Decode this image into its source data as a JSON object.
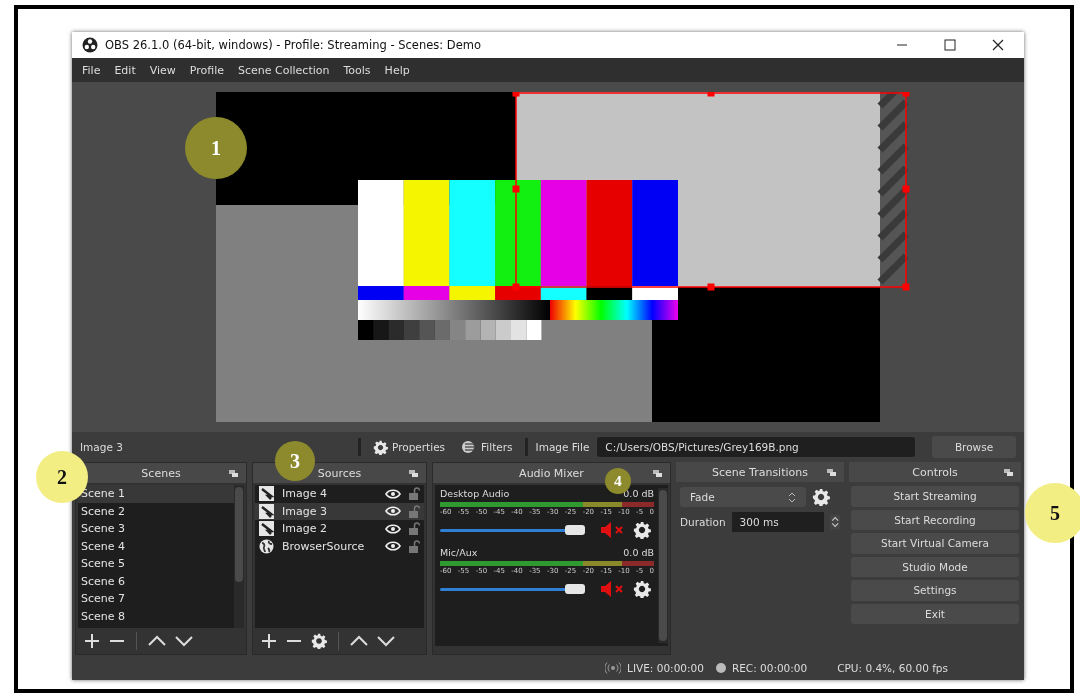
{
  "window": {
    "title": "OBS 26.1.0 (64-bit, windows) - Profile: Streaming - Scenes: Demo"
  },
  "menu": [
    "File",
    "Edit",
    "View",
    "Profile",
    "Scene Collection",
    "Tools",
    "Help"
  ],
  "source_toolbar": {
    "selected_source": "Image 3",
    "properties": "Properties",
    "filters": "Filters",
    "file_label": "Image File",
    "file_path": "C:/Users/OBS/Pictures/Grey169B.png",
    "browse": "Browse"
  },
  "scenes": {
    "title": "Scenes",
    "items": [
      {
        "label": "Scene 1",
        "selected": true
      },
      {
        "label": "Scene 2",
        "selected": false
      },
      {
        "label": "Scene 3",
        "selected": false
      },
      {
        "label": "Scene 4",
        "selected": false
      },
      {
        "label": "Scene 5",
        "selected": false
      },
      {
        "label": "Scene 6",
        "selected": false
      },
      {
        "label": "Scene 7",
        "selected": false
      },
      {
        "label": "Scene 8",
        "selected": false
      }
    ]
  },
  "sources": {
    "title": "Sources",
    "items": [
      {
        "label": "Image 4",
        "kind": "image",
        "selected": false,
        "visible": true,
        "locked": false
      },
      {
        "label": "Image 3",
        "kind": "image",
        "selected": true,
        "visible": true,
        "locked": false
      },
      {
        "label": "Image 2",
        "kind": "image",
        "selected": false,
        "visible": true,
        "locked": false
      },
      {
        "label": "BrowserSource",
        "kind": "browser",
        "selected": false,
        "visible": true,
        "locked": false
      }
    ]
  },
  "audio_mixer": {
    "title": "Audio Mixer",
    "channels": [
      {
        "name": "Desktop Audio",
        "reading": "0.0 dB",
        "scale": [
          "-60",
          "-55",
          "-50",
          "-45",
          "-40",
          "-35",
          "-30",
          "-25",
          "-20",
          "-15",
          "-10",
          "-5",
          "0"
        ],
        "level": 0.87,
        "muted": true
      },
      {
        "name": "Mic/Aux",
        "reading": "0.0 dB",
        "scale": [
          "-60",
          "-55",
          "-50",
          "-45",
          "-40",
          "-35",
          "-30",
          "-25",
          "-20",
          "-15",
          "-10",
          "-5",
          "0"
        ],
        "level": 0.87,
        "muted": true
      }
    ]
  },
  "scene_transitions": {
    "title": "Scene Transitions",
    "transition": "Fade",
    "duration_label": "Duration",
    "duration": "300 ms"
  },
  "controls": {
    "title": "Controls",
    "buttons": [
      "Start Streaming",
      "Start Recording",
      "Start Virtual Camera",
      "Studio Mode",
      "Settings",
      "Exit"
    ]
  },
  "status_bar": {
    "live": "LIVE: 00:00:00",
    "rec": "REC: 00:00:00",
    "cpu": "CPU: 0.4%, 60.00 fps"
  },
  "callouts": [
    {
      "label": "1",
      "color": "#8c8a2c"
    },
    {
      "label": "2",
      "color": "#f3ee84"
    },
    {
      "label": "3",
      "color": "#8c8a2c"
    },
    {
      "label": "4",
      "color": "#8c8a2c"
    },
    {
      "label": "5",
      "color": "#f3ee84"
    }
  ]
}
